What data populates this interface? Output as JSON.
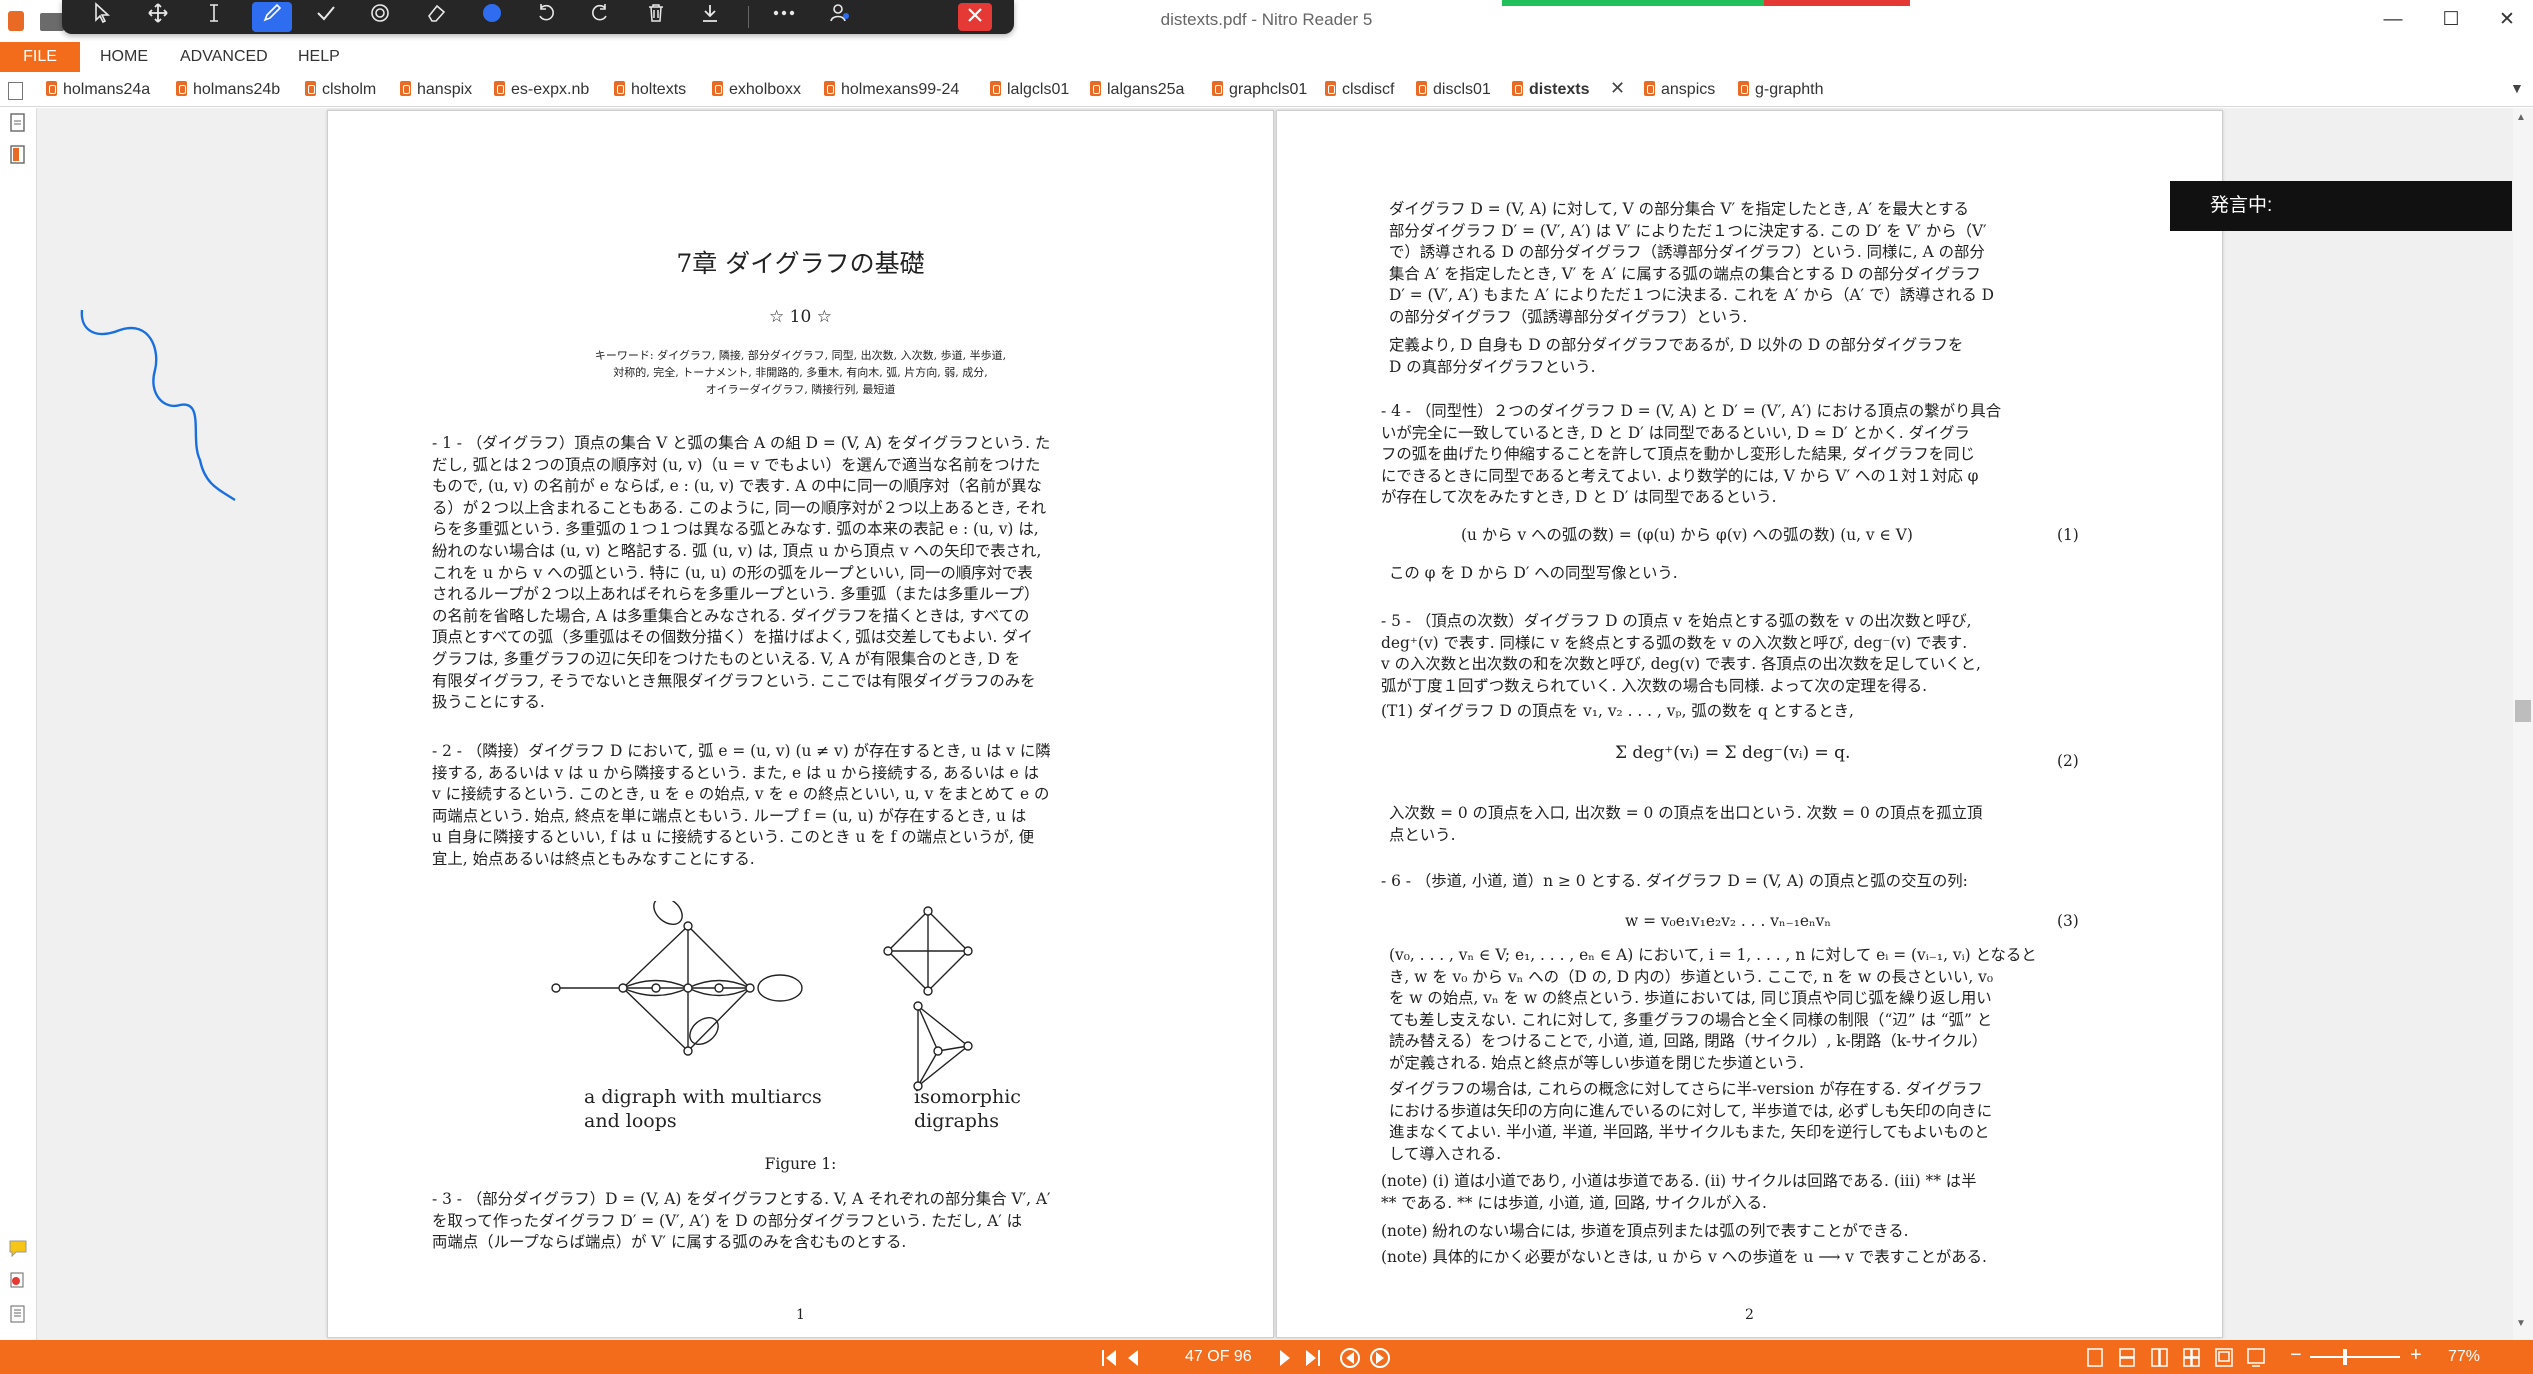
{
  "window": {
    "title": "distexts.pdf - Nitro Reader 5",
    "minimize": "—",
    "maximize": "☐",
    "close": "✕"
  },
  "floating_toolbar": {
    "icons": [
      "select-icon",
      "pan-icon",
      "text-cursor-icon",
      "pen-icon",
      "check-icon",
      "stamp-icon",
      "eraser-icon",
      "color-dot-icon",
      "undo-icon",
      "redo-icon",
      "trash-icon",
      "download-icon",
      "more-icon",
      "user-icon",
      "close-icon"
    ],
    "accent": "#2f6df0"
  },
  "menu": {
    "file": "FILE",
    "home": "HOME",
    "advanced": "ADVANCED",
    "help": "HELP"
  },
  "tabs": [
    "holmans24a",
    "holmans24b",
    "clsholm",
    "hanspix",
    "es-expx.nb",
    "holtexts",
    "exholboxx",
    "holmexans99-24",
    "lalgcls01",
    "lalgans25a",
    "graphcls01",
    "clsdiscf",
    "discls01",
    "distexts",
    "anspics",
    "g-graphth"
  ],
  "active_tab": "distexts",
  "overlay": {
    "speaking": "発言中:"
  },
  "page1": {
    "title": "7章  ダイグラフの基礎",
    "rating": "☆ 10 ☆",
    "keywords": [
      "キーワード: ダイグラフ, 隣接, 部分ダイグラフ, 同型, 出次数, 入次数, 歩道, 半歩道,",
      "対称的, 完全, トーナメント, 非開路的, 多重木, 有向木, 弧, 片方向, 弱, 成分,",
      "オイラーダイグラフ, 隣接行列, 最短道"
    ],
    "para1": [
      "- 1 - （ダイグラフ）頂点の集合 V と弧の集合 A の組 D = (V, A) をダイグラフという. た",
      "だし, 弧とは２つの頂点の順序対 (u, v)（u = v でもよい）を選んで適当な名前をつけた",
      "もので, (u, v) の名前が e ならば, e : (u, v) で表す. A の中に同一の順序対（名前が異な",
      "る）が２つ以上含まれることもある. このように, 同一の順序対が２つ以上あるとき, それ",
      "らを多重弧という. 多重弧の１つ１つは異なる弧とみなす. 弧の本来の表記 e : (u, v) は,",
      "紛れのない場合は (u, v) と略記する. 弧 (u, v) は, 頂点 u から頂点 v への矢印で表され,",
      "これを u から v への弧という. 特に (u, u) の形の弧をループといい, 同一の順序対で表",
      "されるループが２つ以上あればそれらを多重ループという. 多重弧（または多重ループ）",
      "の名前を省略した場合, A は多重集合とみなされる. ダイグラフを描くときは, すべての",
      "頂点とすべての弧（多重弧はその個数分描く）を描けばよく, 弧は交差してもよい. ダイ",
      "グラフは, 多重グラフの辺に矢印をつけたものといえる. V, A が有限集合のとき, D を",
      "有限ダイグラフ, そうでないとき無限ダイグラフという. ここでは有限ダイグラフのみを",
      "扱うことにする."
    ],
    "para2": [
      "- 2 - （隣接）ダイグラフ D において, 弧 e = (u, v) (u ≠ v) が存在するとき, u は v に隣",
      "接する, あるいは v は u から隣接するという. また, e は u から接続する, あるいは e は",
      "v に接続するという. このとき, u を e の始点, v を e の終点といい, u, v をまとめて e の",
      "両端点という. 始点, 終点を単に端点ともいう. ループ f = (u, u) が存在するとき, u は",
      "u 自身に隣接するといい, f は u に接続するという. このとき u を f の端点というが, 便",
      "宜上, 始点あるいは終点ともみなすことにする."
    ],
    "fig_caption_left": [
      "a digraph with multiarcs",
      "and loops"
    ],
    "fig_caption_right": [
      "isomorphic",
      "digraphs"
    ],
    "figure_label": "Figure 1:",
    "para3": [
      "- 3 - （部分ダイグラフ）D = (V, A) をダイグラフとする. V, A それぞれの部分集合 V′, A′",
      "を取って作ったダイグラフ D′ = (V′, A′) を D の部分ダイグラフという. ただし, A′ は",
      "両端点（ループならば端点）が V′ に属する弧のみを含むものとする."
    ],
    "page_number": "1"
  },
  "page2": {
    "para1": [
      "ダイグラフ D = (V, A) に対して, V の部分集合 V′ を指定したとき, A′ を最大とする",
      "部分ダイグラフ D′ = (V′, A′) は V′ によりただ１つに決定する. この D′ を V′ から（V′",
      "で）誘導される D の部分ダイグラフ（誘導部分ダイグラフ）という. 同様に, A の部分",
      "集合 A′ を指定したとき, V′ を A′ に属する弧の端点の集合とする D の部分ダイグラフ",
      "D′ = (V′, A′) もまた A′ によりただ１つに決まる. これを A′ から（A′ で）誘導される D",
      "の部分ダイグラフ（弧誘導部分ダイグラフ）という."
    ],
    "para2": [
      "定義より, D 自身も D の部分ダイグラフであるが, D 以外の D の部分ダイグラフを",
      "D の真部分ダイグラフという."
    ],
    "para4": [
      "- 4 - （同型性）２つのダイグラフ D = (V, A) と D′ = (V′, A′) における頂点の繋がり具合",
      "いが完全に一致しているとき, D と D′ は同型であるといい, D ≃ D′ とかく. ダイグラ",
      "フの弧を曲げたり伸縮することを許して頂点を動かし変形した結果, ダイグラフを同じ",
      "にできるときに同型であると考えてよい. より数学的には, V から V′ への１対１対応 φ",
      "が存在して次をみたすとき, D と D′ は同型であるという."
    ],
    "eq1": "(u から v への弧の数) = (φ(u) から φ(v) への弧の数)        (u, v ∈ V)",
    "eq1_num": "(1)",
    "para4b": "この φ を D から D′ への同型写像という.",
    "para5": [
      "- 5 - （頂点の次数）ダイグラフ D の頂点 v を始点とする弧の数を v の出次数と呼び,",
      "deg⁺(v) で表す. 同様に v を終点とする弧の数を v の入次数と呼び, deg⁻(v) で表す.",
      "v の入次数と出次数の和を次数と呼び, deg(v) で表す. 各頂点の出次数を足していくと,",
      "弧が丁度１回ずつ数えられていく. 入次数の場合も同様. よって次の定理を得る."
    ],
    "theorem": "(T1)  ダイグラフ D の頂点を v₁, v₂ . . . , vₚ, 弧の数を q とするとき,",
    "eq2": "Σ deg⁺(vᵢ) = Σ deg⁻(vᵢ) = q.",
    "eq2_num": "(2)",
    "para5b": [
      "入次数 = 0 の頂点を入口, 出次数 = 0 の頂点を出口という. 次数 = 0 の頂点を孤立頂",
      "点という."
    ],
    "para6": "- 6 - （歩道, 小道, 道）n ≥ 0 とする. ダイグラフ D = (V, A) の頂点と弧の交互の列:",
    "eq3": "w = v₀e₁v₁e₂v₂ . . . vₙ₋₁eₙvₙ",
    "eq3_num": "(3)",
    "para6b": [
      "(v₀, . . . , vₙ ∈ V; e₁, . . . , eₙ ∈ A) において, i = 1, . . . , n に対して eᵢ = (vᵢ₋₁, vᵢ) となると",
      "き, w を v₀ から vₙ への（D の, D 内の）歩道という. ここで, n を w の長さといい, v₀",
      "を w の始点, vₙ を w の終点という. 歩道においては, 同じ頂点や同じ弧を繰り返し用い",
      "ても差し支えない. これに対して, 多重グラフの場合と全く同様の制限（“辺” は “弧” と",
      "読み替える）をつけることで, 小道, 道, 回路, 閉路（サイクル）, k-閉路（k-サイクル）",
      "が定義される. 始点と終点が等しい歩道を閉じた歩道という."
    ],
    "para6c": [
      "ダイグラフの場合は, これらの概念に対してさらに半-version が存在する. ダイグラフ",
      "における歩道は矢印の方向に進んでいるのに対して, 半歩道では, 必ずしも矢印の向きに",
      "進まなくてよい. 半小道, 半道, 半回路, 半サイクルもまた, 矢印を逆行してもよいものと",
      "して導入される."
    ],
    "note1": [
      "(note)  (i) 道は小道であり, 小道は歩道である. (ii) サイクルは回路である. (iii) ** は半",
      "** である. ** には歩道, 小道, 道, 回路, サイクルが入る."
    ],
    "note2": "(note)  紛れのない場合には, 歩道を頂点列または弧の列で表すことができる.",
    "note3": "(note)  具体的にかく必要がないときは, u から v への歩道を u ⟶ v で表すことがある.",
    "page_number": "2"
  },
  "status": {
    "page_indicator": "47 OF 96",
    "zoom": "77%",
    "zoom_minus": "−",
    "zoom_plus": "+"
  }
}
